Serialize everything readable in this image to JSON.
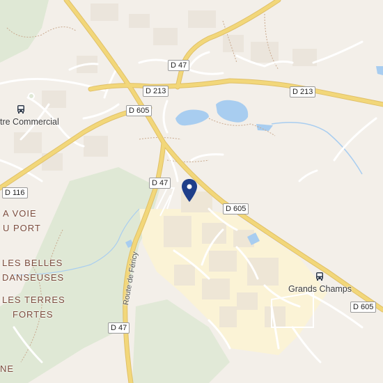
{
  "map": {
    "roads": {
      "d47_top": "D 47",
      "d213_left": "D 213",
      "d213_right": "D 213",
      "d605_top": "D 605",
      "d605_mid": "D 605",
      "d605_right": "D 605",
      "d47_mid": "D 47",
      "d47_bottom": "D 47",
      "d116": "D 116"
    },
    "areas": {
      "la_voie_line1": "A VOIE",
      "la_voie_line2": "U PORT",
      "belles_line1": "LES BELLES",
      "belles_line2": "DANSEUSES",
      "terres_line1": "LES TERRES",
      "terres_line2": "FORTES",
      "ne": "NE"
    },
    "pois": {
      "centre_commercial": "tre Commercial",
      "grands_champs": "Grands Champs"
    },
    "streets": {
      "route_de_fericy": "Route de Féricy"
    },
    "icons": {
      "bus": "bus-stop-icon",
      "pin": "location-pin-icon"
    },
    "colors": {
      "background": "#f3efe9",
      "major_road": "#f2d77a",
      "road_casing": "#e0c068",
      "minor_road": "#ffffff",
      "water": "#a8cdf0",
      "green": "#dfe8d5",
      "industrial": "#fbf3d6",
      "pin": "#1f3f8a"
    }
  }
}
